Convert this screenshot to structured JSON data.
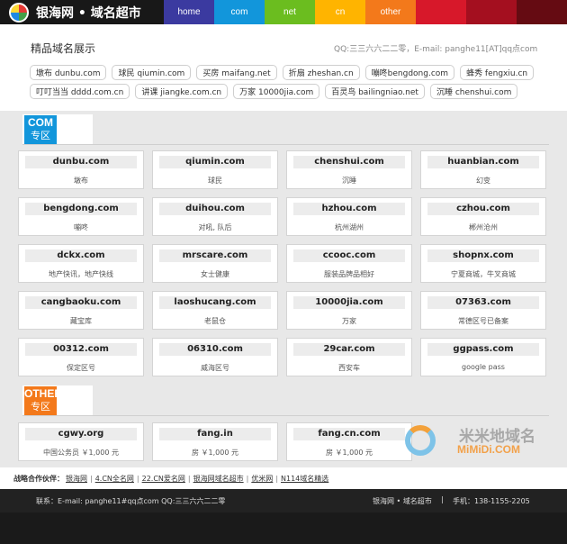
{
  "header": {
    "logo_text": "银海网 • 域名超市",
    "nav": [
      "home",
      "com",
      "net",
      "cn",
      "other",
      "",
      ""
    ]
  },
  "showcase": {
    "title": "精品域名展示",
    "contact": "QQ:三三六六二二零，E-mail: panghe11[AT]qq点com",
    "tags_row1": [
      "墩布 dunbu.com",
      "球民 qiumin.com",
      "买房 maifang.net",
      "折扇 zheshan.cn",
      "嘣咚bengdong.com",
      "蜂秀 fengxiu.cn"
    ],
    "tags_row2": [
      "叮叮当当 dddd.com.cn",
      "讲课 jiangke.com.cn",
      "万家 10000jia.com",
      "百灵鸟 bailingniao.net",
      "沉睡 chenshui.com"
    ]
  },
  "zones": {
    "com": {
      "top": "COM",
      "bottom": "专区"
    },
    "other": {
      "top": "OTHER",
      "bottom": "专区"
    }
  },
  "com_cards": [
    {
      "name": "dunbu.com",
      "desc": "墩布"
    },
    {
      "name": "qiumin.com",
      "desc": "球民"
    },
    {
      "name": "chenshui.com",
      "desc": "沉睡"
    },
    {
      "name": "huanbian.com",
      "desc": "幻变"
    },
    {
      "name": "bengdong.com",
      "desc": "嘣咚"
    },
    {
      "name": "duihou.com",
      "desc": "对吼, 队后"
    },
    {
      "name": "hzhou.com",
      "desc": "杭州湖州"
    },
    {
      "name": "czhou.com",
      "desc": "郴州沧州"
    },
    {
      "name": "dckx.com",
      "desc": "地产快讯，地产快线"
    },
    {
      "name": "mrscare.com",
      "desc": "女士健康"
    },
    {
      "name": "ccooc.com",
      "desc": "服装品牌品相好"
    },
    {
      "name": "shopnx.com",
      "desc": "宁夏商城，牛叉商城"
    },
    {
      "name": "cangbaoku.com",
      "desc": "藏宝库"
    },
    {
      "name": "laoshucang.com",
      "desc": "老鼠仓"
    },
    {
      "name": "10000jia.com",
      "desc": "万家"
    },
    {
      "name": "07363.com",
      "desc": "常德区号已备案"
    },
    {
      "name": "00312.com",
      "desc": "保定区号"
    },
    {
      "name": "06310.com",
      "desc": "威海区号"
    },
    {
      "name": "29car.com",
      "desc": "西安车"
    },
    {
      "name": "ggpass.com",
      "desc": "google pass"
    }
  ],
  "other_cards": [
    {
      "name": "cgwy.org",
      "desc": "中国公务员 ￥1,000 元"
    },
    {
      "name": "fang.in",
      "desc": "房 ￥1,000 元"
    },
    {
      "name": "fang.cn.com",
      "desc": "房 ￥1,000 元"
    }
  ],
  "partners": {
    "label": "战略合作伙伴：",
    "links": [
      "银海网",
      "4.CN全名网",
      "22.CN爱名网",
      "银海网域名超市",
      "优米网",
      "N114域名精选"
    ]
  },
  "footer": {
    "contact": "联系：E-mail: panghe11#qq点com QQ:三三六六二二零",
    "brand": "银海网 • 域名超市",
    "sep": "|",
    "phone": "手机：138-1155-2205"
  },
  "watermark": {
    "cn": "米米地域名",
    "en": "MiMiDi.COM"
  }
}
